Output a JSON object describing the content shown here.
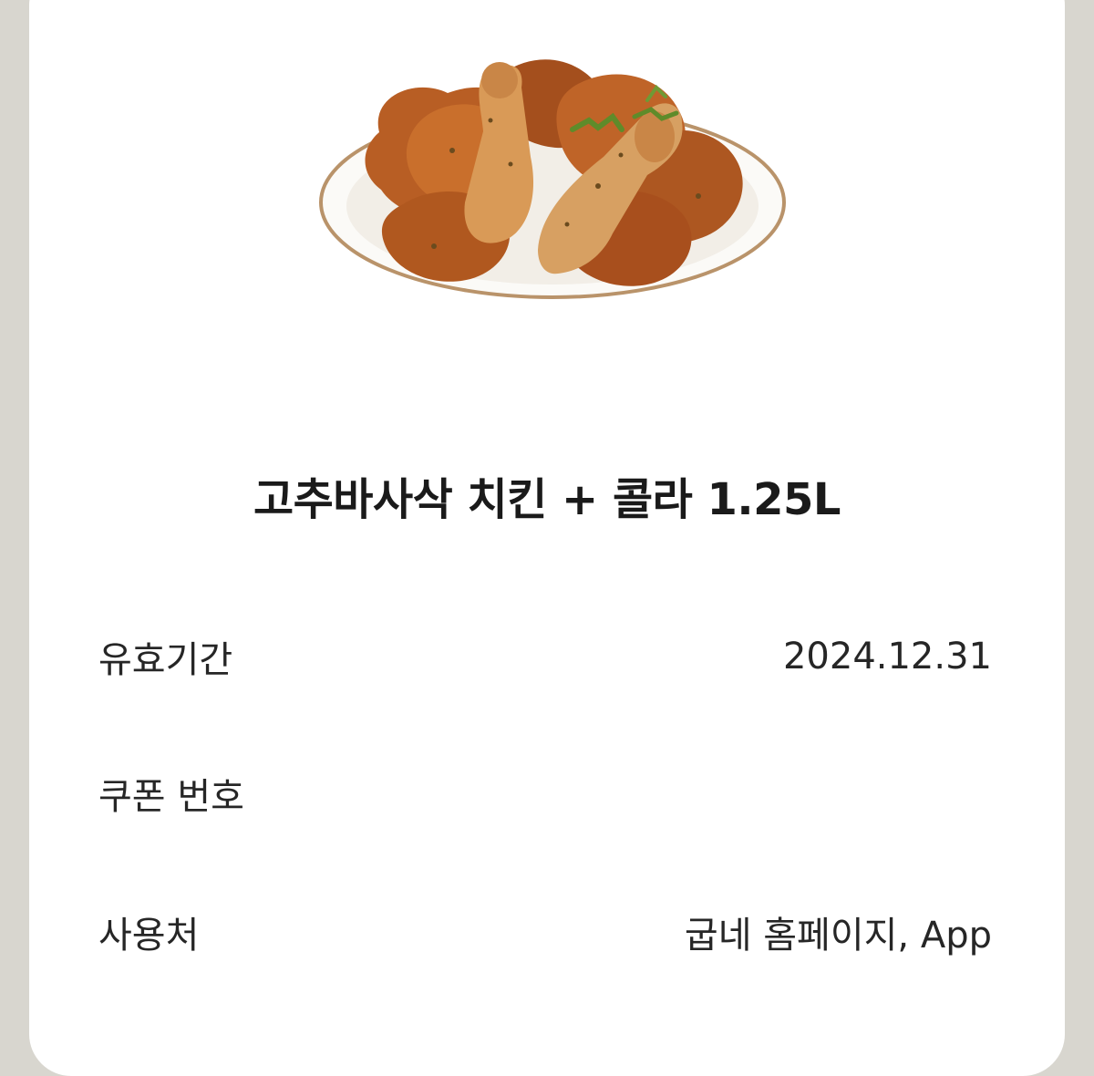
{
  "product": {
    "title": "고추바사삭 치킨 + 콜라 1.25L",
    "image_icon": "fried-chicken-plate"
  },
  "info": {
    "validity_label": "유효기간",
    "validity_value": "2024.12.31",
    "coupon_label": "쿠폰 번호",
    "coupon_value": "",
    "usage_label": "사용처",
    "usage_value": "굽네 홈페이지, App"
  },
  "colors": {
    "background": "#d8d6cf",
    "card": "#ffffff",
    "text": "#1a1a1a",
    "plate_rim": "#b9936a"
  }
}
